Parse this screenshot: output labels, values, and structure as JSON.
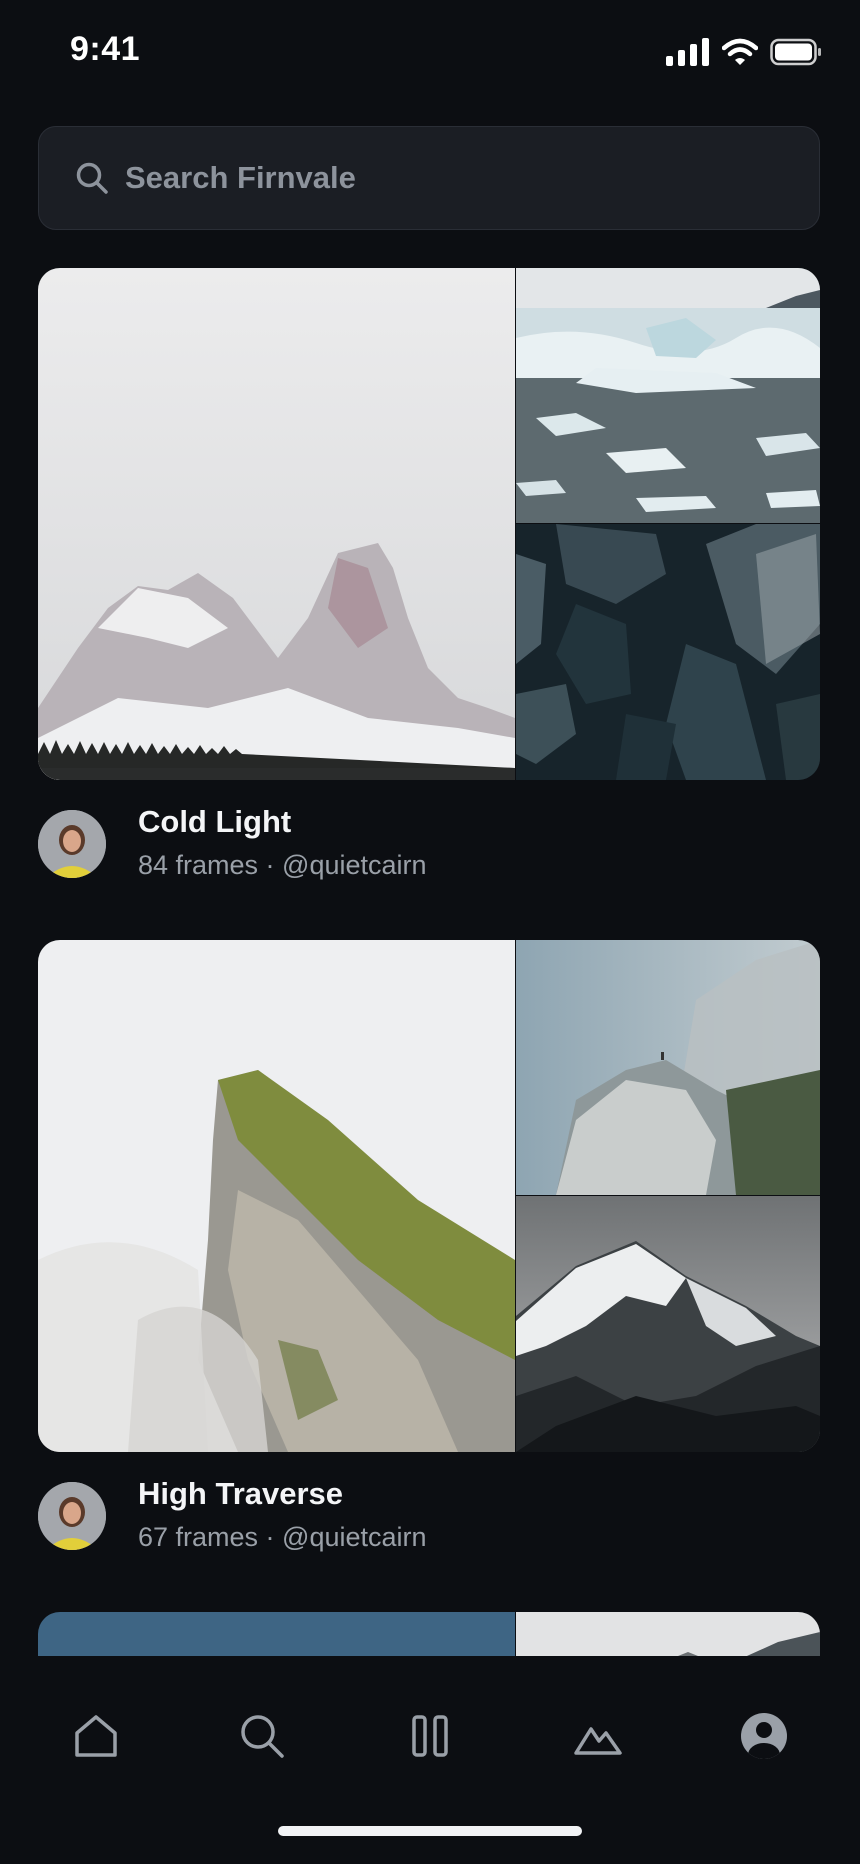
{
  "status_bar": {
    "time": "9:41",
    "icons": [
      "signal-icon",
      "wifi-icon",
      "battery-icon"
    ]
  },
  "search": {
    "placeholder": "Search Firnvale",
    "value": ""
  },
  "collections": [
    {
      "title": "Cold Light",
      "subtitle": "84 frames · @quietcairn",
      "images": [
        "snowy-mountain-peaks",
        "floating-icebergs",
        "dark-ice-crystals"
      ]
    },
    {
      "title": "High Traverse",
      "subtitle": "67 frames · @quietcairn",
      "images": [
        "grassy-ridge-in-fog",
        "hiker-on-misty-cliff",
        "snowy-mountain-range"
      ]
    }
  ],
  "tab_bar": {
    "items": [
      "home-icon",
      "search-icon",
      "collections-icon",
      "mountain-icon",
      "profile-icon"
    ]
  },
  "colors": {
    "background": "#0c0e12",
    "search_field": "#1b1e24",
    "muted_text": "#9aa0a8"
  }
}
